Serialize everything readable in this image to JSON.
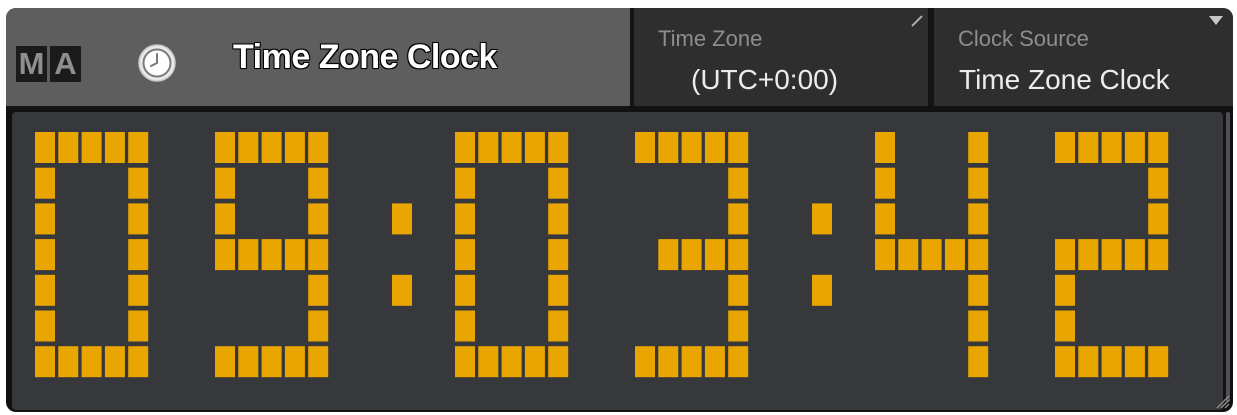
{
  "window": {
    "logo_letters": [
      "M",
      "A"
    ],
    "title_icon": "clock-icon",
    "title": "Time Zone Clock"
  },
  "time_zone": {
    "label": "Time Zone",
    "value": "(UTC+0:00)",
    "icon": "edit-icon"
  },
  "clock_source": {
    "label": "Clock Source",
    "value": "Time Zone Clock",
    "icon": "dropdown-arrow-icon"
  },
  "clock": {
    "time": "09:03:42",
    "digit_color": "#eaa600",
    "background": "#37383c"
  }
}
